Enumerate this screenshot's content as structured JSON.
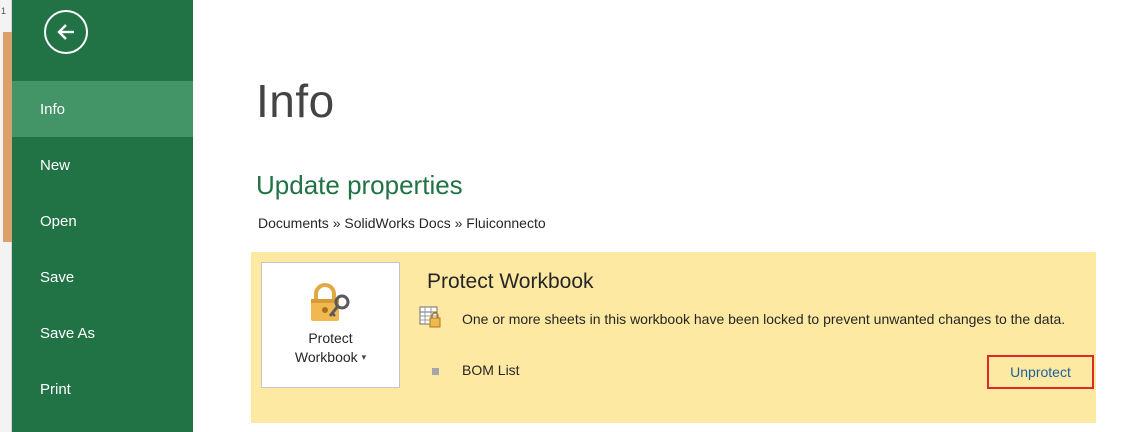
{
  "edge": {
    "row_number": "1"
  },
  "sidebar": {
    "back_label": "",
    "items": [
      {
        "label": "Info",
        "active": true
      },
      {
        "label": "New",
        "active": false
      },
      {
        "label": "Open",
        "active": false
      },
      {
        "label": "Save",
        "active": false
      },
      {
        "label": "Save As",
        "active": false
      },
      {
        "label": "Print",
        "active": false
      }
    ]
  },
  "main": {
    "title": "Info",
    "section_title": "Update properties",
    "breadcrumb": "Documents » SolidWorks Docs » Fluiconnecto"
  },
  "protect": {
    "button_label_line1": "Protect",
    "button_label_line2": "Workbook",
    "caret": "▾",
    "heading": "Protect Workbook",
    "message": "One or more sheets in this workbook have been locked to prevent unwanted changes to the data.",
    "sheet_name": "BOM List",
    "unprotect_label": "Unprotect"
  },
  "colors": {
    "sidebar": "#217346",
    "sidebar_active": "#439467",
    "accent_text": "#217346",
    "panel": "#fde9a1",
    "highlight_border": "#e02828",
    "link": "#1f5f9e"
  }
}
